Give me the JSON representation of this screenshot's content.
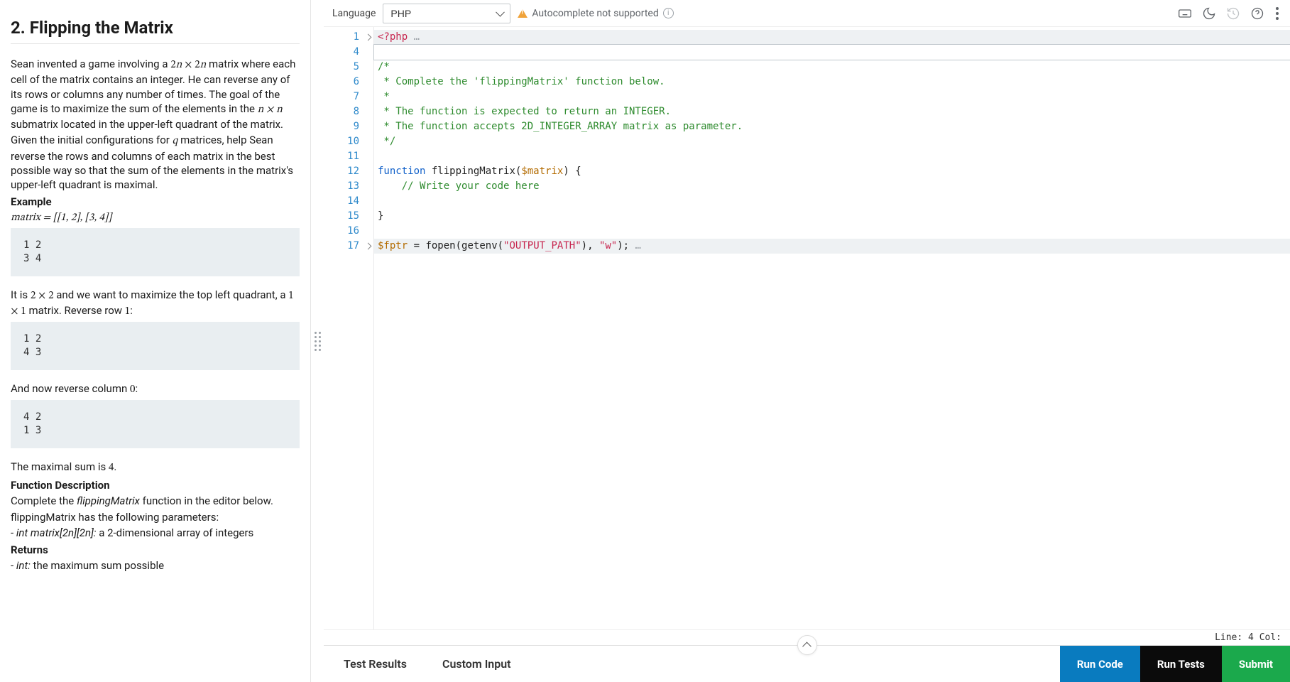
{
  "problem": {
    "title": "2. Flipping the Matrix",
    "intro_html": "Sean invented a game involving a <span class='math upright'>2<span class='math'>n</span> × 2<span class='math'>n</span></span> matrix where each cell of the matrix contains an integer. He can reverse any of its rows or columns any number of times. The goal of the game is to maximize the sum of the elements in the <span class='math'>n × n</span> submatrix located in the upper-left quadrant of the matrix.",
    "intro2_html": "Given the initial configurations for <span class='math'>q</span> matrices, help Sean reverse the rows and columns of each matrix in the best possible way so that the sum of the elements in the matrix's upper-left quadrant is maximal.",
    "example_label": "Example",
    "matrix_eq": "matrix = [[1, 2], [3, 4]]",
    "code1": "1 2\n3 4",
    "para_after_code1_html": "It is <span class='math upright'>2 × 2</span> and we want to maximize the top left quadrant, a <span class='math upright'>1 × 1</span> matrix. Reverse row <span class='math upright'>1</span>:",
    "code2": "1 2\n4 3",
    "para_after_code2_html": "And now reverse column <span class='math upright'>0</span>:",
    "code3": "4 2\n1 3",
    "maximal_html": "The maximal sum is <span class='math upright'>4</span>.",
    "fn_desc_head": "Function Description",
    "fn_desc_body_html": "Complete the <span class='fn-italic'>flippingMatrix</span> function in the editor below.",
    "fn_params_head": "flippingMatrix has the following parameters:",
    "fn_param1_html": "- <span class='fn-italic'>int matrix[2n][2n]:</span> a 2-dimensional array of integers",
    "returns_head": "Returns",
    "returns_body_html": "- <span class='fn-italic'>int:</span> the maximum sum possible"
  },
  "toolbar": {
    "language_label": "Language",
    "language_value": "PHP",
    "autocomplete_warning": "Autocomplete not supported"
  },
  "editor": {
    "lines": [
      {
        "n": 1,
        "fold": true,
        "hl": true,
        "html": "<span class='tok-red'>&lt;?php</span> <span class='fold-dots'>…</span>"
      },
      {
        "n": 4,
        "fold": false,
        "active": true,
        "html": ""
      },
      {
        "n": 5,
        "fold": false,
        "html": "<span class='tok-green'>/*</span>"
      },
      {
        "n": 6,
        "fold": false,
        "html": "<span class='tok-green'> * Complete the 'flippingMatrix' function below.</span>"
      },
      {
        "n": 7,
        "fold": false,
        "html": "<span class='tok-green'> *</span>"
      },
      {
        "n": 8,
        "fold": false,
        "html": "<span class='tok-green'> * The function is expected to return an INTEGER.</span>"
      },
      {
        "n": 9,
        "fold": false,
        "html": "<span class='tok-green'> * The function accepts 2D_INTEGER_ARRAY matrix as parameter.</span>"
      },
      {
        "n": 10,
        "fold": false,
        "html": "<span class='tok-green'> */</span>"
      },
      {
        "n": 11,
        "fold": false,
        "html": ""
      },
      {
        "n": 12,
        "fold": false,
        "html": "<span class='tok-kw'>function</span> <span class='tok-fn'>flippingMatrix</span>(<span class='tok-var'>$matrix</span>) {"
      },
      {
        "n": 13,
        "fold": false,
        "html": "    <span class='tok-green'>// Write your code here</span>"
      },
      {
        "n": 14,
        "fold": false,
        "html": ""
      },
      {
        "n": 15,
        "fold": false,
        "html": "}"
      },
      {
        "n": 16,
        "fold": false,
        "html": ""
      },
      {
        "n": 17,
        "fold": true,
        "hl": true,
        "html": "<span class='tok-var'>$fptr</span> = <span class='tok-fn'>fopen</span>(<span class='tok-fn'>getenv</span>(<span class='tok-str'>\"OUTPUT_PATH\"</span>), <span class='tok-str'>\"w\"</span>); <span class='fold-dots'>…</span>"
      }
    ]
  },
  "status": {
    "text": "Line: 4 Col:"
  },
  "bottom": {
    "tab_results": "Test Results",
    "tab_custom": "Custom Input",
    "run_code": "Run Code",
    "run_tests": "Run Tests",
    "submit": "Submit"
  }
}
